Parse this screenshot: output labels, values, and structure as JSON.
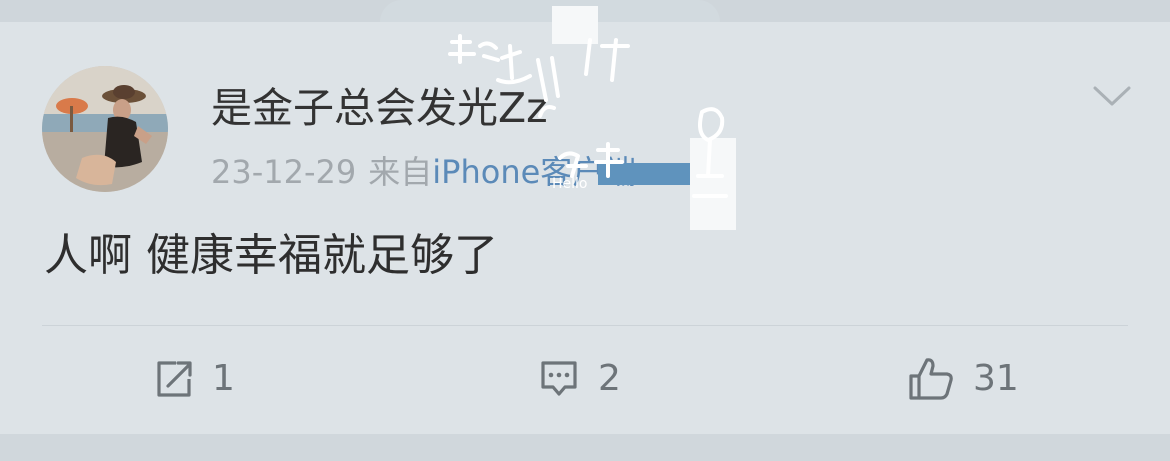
{
  "post": {
    "username": "是金子总会发光Zz",
    "date": "23-12-29",
    "from_label": "来自",
    "source": "iPhone客户端",
    "text": "人啊 健康幸福就足够了"
  },
  "actions": {
    "repost": {
      "icon": "share-icon",
      "count": "1"
    },
    "comment": {
      "icon": "comment-icon",
      "count": "2"
    },
    "like": {
      "icon": "thumbs-up-icon",
      "count": "31"
    }
  },
  "overlay": {
    "watermark_text": "Hello"
  },
  "colors": {
    "background": "#dde3e7",
    "username": "#333333",
    "meta": "#a2a8ad",
    "source_link": "#5b8ab8",
    "icon": "#6d7479"
  }
}
